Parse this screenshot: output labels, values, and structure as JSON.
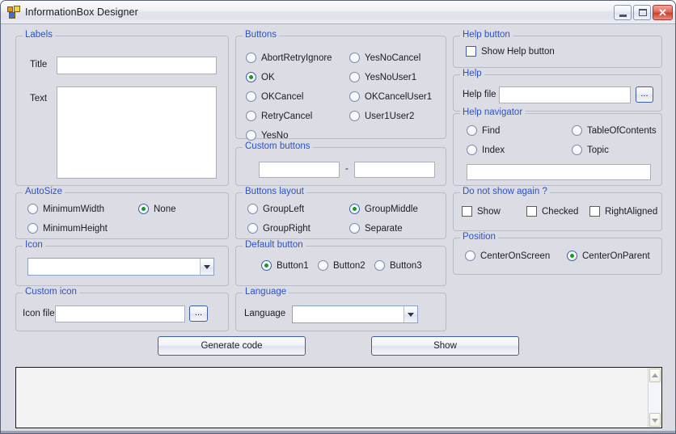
{
  "window": {
    "title": "InformationBox Designer",
    "icon": "winforms-app-icon",
    "minimize_label": "Minimize",
    "maximize_label": "Maximize",
    "close_label": "✕"
  },
  "colors": {
    "form_background": "#dcdce4",
    "group_label": "#2b52c8",
    "group_border": "#b7bcc9",
    "radio_selected_dot": "#199a1f",
    "textbox_background": "#ffffff",
    "output_background": "#f3f3f3"
  },
  "groups": {
    "labels": {
      "title": "Labels",
      "title_label": "Title",
      "title_value": "",
      "text_label": "Text",
      "text_value": ""
    },
    "buttons": {
      "title": "Buttons",
      "options_left": [
        {
          "label": "AbortRetryIgnore",
          "selected": false
        },
        {
          "label": "OK",
          "selected": true
        },
        {
          "label": "OKCancel",
          "selected": false
        },
        {
          "label": "RetryCancel",
          "selected": false
        },
        {
          "label": "YesNo",
          "selected": false
        }
      ],
      "options_right": [
        {
          "label": "YesNoCancel",
          "selected": false
        },
        {
          "label": "YesNoUser1",
          "selected": false
        },
        {
          "label": "OKCancelUser1",
          "selected": false
        },
        {
          "label": "User1User2",
          "selected": false
        }
      ]
    },
    "custom_buttons": {
      "title": "Custom buttons",
      "first_value": "",
      "separator": "-",
      "second_value": ""
    },
    "help_button": {
      "title": "Help button",
      "show_help_label": "Show Help button",
      "show_help_checked": false
    },
    "help": {
      "title": "Help",
      "help_file_label": "Help file",
      "help_file_value": "",
      "browse_label": "..."
    },
    "help_navigator": {
      "title": "Help navigator",
      "options": [
        {
          "label": "Find",
          "selected": false
        },
        {
          "label": "TableOfContents",
          "selected": false
        },
        {
          "label": "Index",
          "selected": false
        },
        {
          "label": "Topic",
          "selected": false
        }
      ],
      "parameter_value": ""
    },
    "autosize": {
      "title": "AutoSize",
      "options": [
        {
          "label": "MinimumWidth",
          "selected": false
        },
        {
          "label": "None",
          "selected": true
        },
        {
          "label": "MinimumHeight",
          "selected": false
        }
      ]
    },
    "icon": {
      "title": "Icon",
      "selected_value": ""
    },
    "custom_icon": {
      "title": "Custom icon",
      "icon_file_label": "Icon file",
      "icon_file_value": "",
      "browse_label": "..."
    },
    "buttons_layout": {
      "title": "Buttons layout",
      "options": [
        {
          "label": "GroupLeft",
          "selected": false
        },
        {
          "label": "GroupMiddle",
          "selected": true
        },
        {
          "label": "GroupRight",
          "selected": false
        },
        {
          "label": "Separate",
          "selected": false
        }
      ]
    },
    "default_button": {
      "title": "Default button",
      "options": [
        {
          "label": "Button1",
          "selected": true
        },
        {
          "label": "Button2",
          "selected": false
        },
        {
          "label": "Button3",
          "selected": false
        }
      ]
    },
    "language": {
      "title": "Language",
      "language_label": "Language",
      "selected_value": ""
    },
    "do_not_show_again": {
      "title": "Do not show again ?",
      "options": [
        {
          "label": "Show",
          "checked": false
        },
        {
          "label": "Checked",
          "checked": false
        },
        {
          "label": "RightAligned",
          "checked": false
        }
      ]
    },
    "position": {
      "title": "Position",
      "options": [
        {
          "label": "CenterOnScreen",
          "selected": false
        },
        {
          "label": "CenterOnParent",
          "selected": true
        }
      ]
    }
  },
  "actions": {
    "generate_code_label": "Generate code",
    "show_label": "Show"
  },
  "output": {
    "value": "",
    "scroll_up_icon": "chevron-up-icon",
    "scroll_down_icon": "chevron-down-icon"
  }
}
